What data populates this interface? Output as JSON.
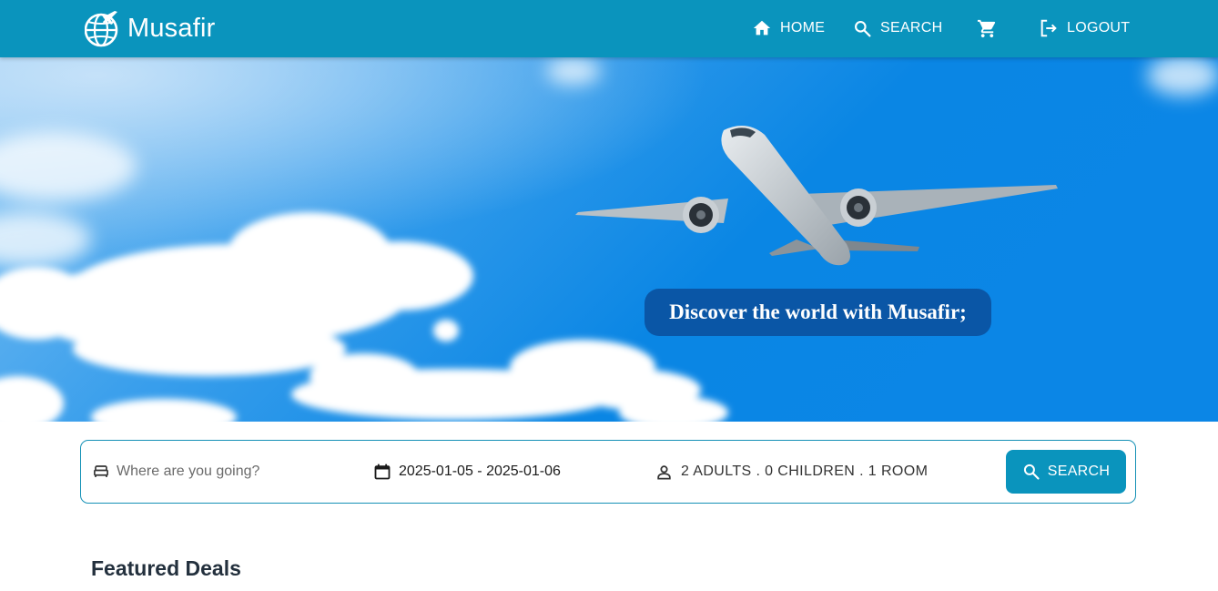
{
  "brand": {
    "name": "Musafir",
    "logo_icon": "globe-plane-icon"
  },
  "nav": {
    "home_label": "HOME",
    "search_label": "SEARCH",
    "logout_label": "LOGOUT",
    "cart_icon": "cart-icon"
  },
  "hero": {
    "tagline": "Discover the world with Musafir;"
  },
  "search": {
    "destination_placeholder": "Where are you going?",
    "destination_value": "",
    "dates": "2025-01-05 - 2025-01-06",
    "guests": "2 ADULTS . 0 CHILDREN . 1 ROOM",
    "button_label": "SEARCH"
  },
  "featured": {
    "title": "Featured Deals"
  },
  "colors": {
    "primary": "#0a94bd",
    "tagline_bg": "#0a56a6",
    "heading": "#23303d"
  }
}
